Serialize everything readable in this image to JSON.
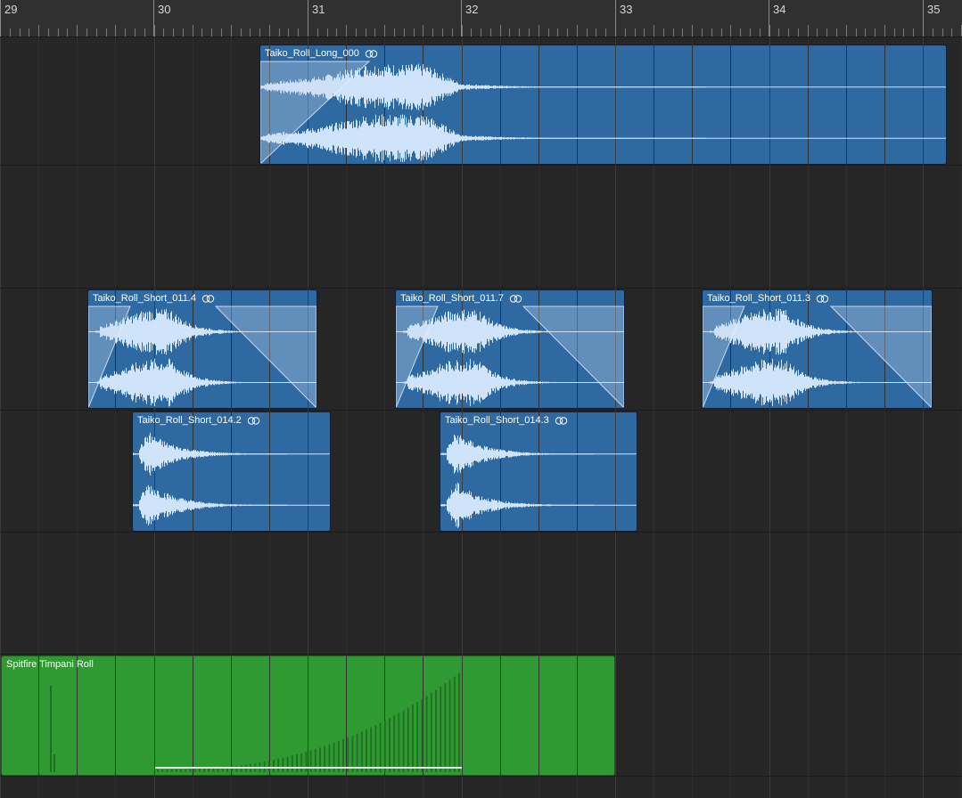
{
  "ruler": {
    "bars": [
      "29",
      "30",
      "31",
      "32",
      "33",
      "34",
      "35"
    ]
  },
  "regions": [
    {
      "id": "long",
      "name": "Taiko_Roll_Long_000",
      "type": "audio",
      "looped": true
    },
    {
      "id": "s1",
      "name": "Taiko_Roll_Short_011.4",
      "type": "audio",
      "looped": true
    },
    {
      "id": "s2",
      "name": "Taiko_Roll_Short_011.7",
      "type": "audio",
      "looped": true
    },
    {
      "id": "s3",
      "name": "Taiko_Roll_Short_011.3",
      "type": "audio",
      "looped": true
    },
    {
      "id": "s4",
      "name": "Taiko_Roll_Short_014.2",
      "type": "audio",
      "looped": true
    },
    {
      "id": "s5",
      "name": "Taiko_Roll_Short_014.3",
      "type": "audio",
      "looped": true
    },
    {
      "id": "midi",
      "name": "Spitfire Timpani Roll",
      "type": "midi",
      "looped": false
    }
  ],
  "colors": {
    "audio_region": "#2f69a1",
    "midi_region": "#2f9a32",
    "waveform": "#cfe3fb",
    "background": "#262626"
  }
}
